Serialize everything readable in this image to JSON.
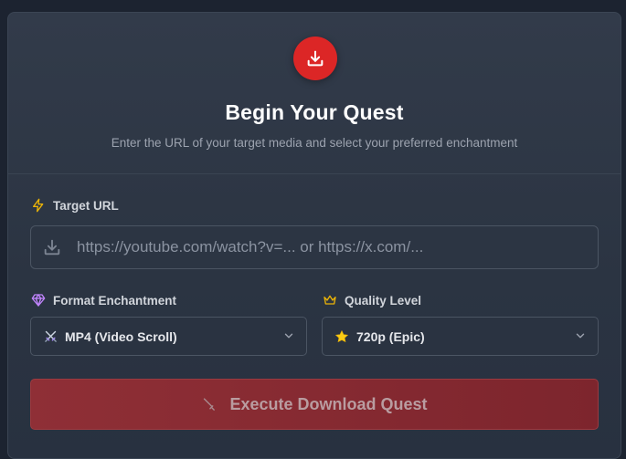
{
  "header": {
    "title": "Begin Your Quest",
    "subtitle": "Enter the URL of your target media and select your preferred enchantment",
    "icon": "download-icon",
    "icon_color": "#dc2626"
  },
  "url_field": {
    "label": "Target URL",
    "label_icon": "lightning-bolt-icon",
    "placeholder": "https://youtube.com/watch?v=... or https://x.com/...",
    "value": "",
    "input_icon": "download-icon"
  },
  "format": {
    "label": "Format Enchantment",
    "label_icon": "diamond-icon",
    "selected": "MP4 (Video Scroll)",
    "option_icon": "crossed-swords-icon"
  },
  "quality": {
    "label": "Quality Level",
    "label_icon": "crown-icon",
    "selected": "720p (Epic)",
    "option_icon": "star-icon"
  },
  "execute_button": {
    "label": "Execute Download Quest",
    "icon": "sword-icon",
    "state": "disabled"
  },
  "colors": {
    "accent": "#dc2626",
    "label_icon_gold": "#eab308",
    "label_icon_purple": "#c084fc"
  }
}
